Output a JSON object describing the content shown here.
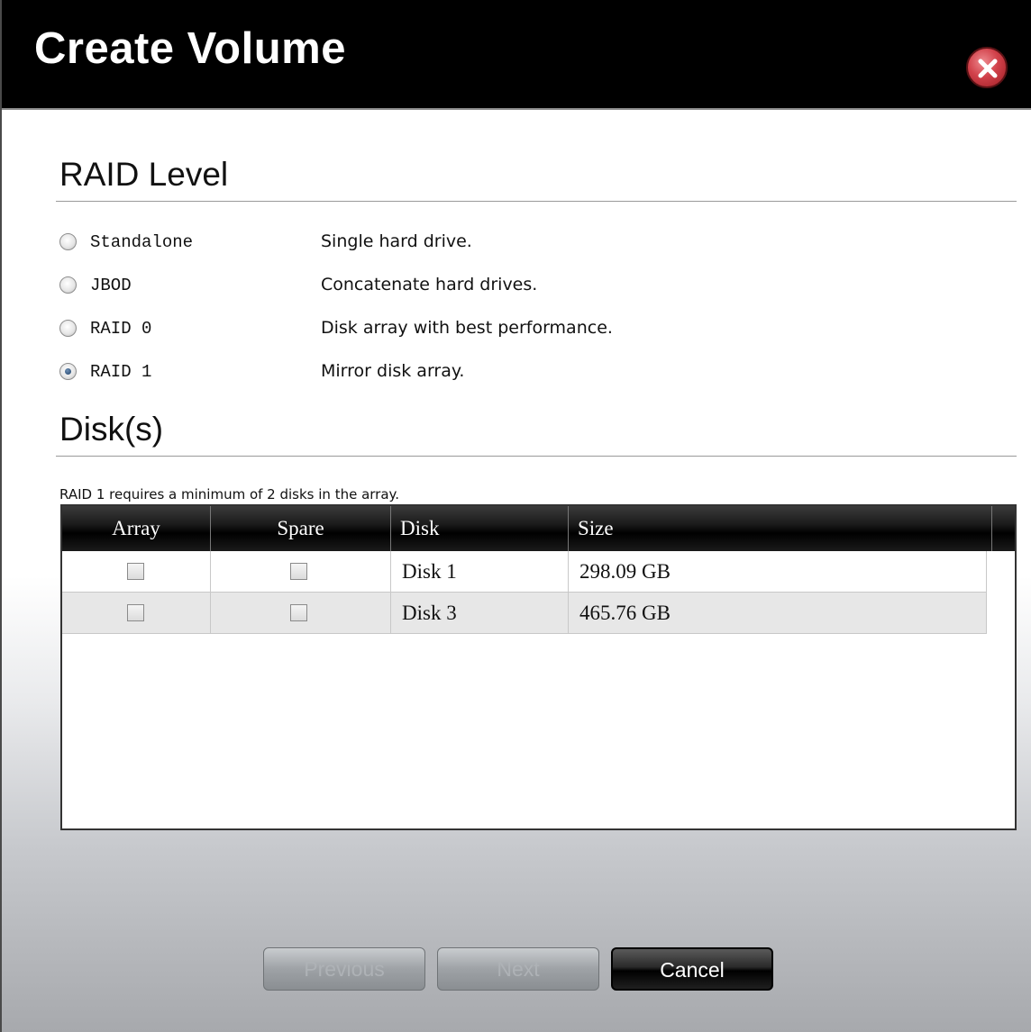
{
  "dialog": {
    "title": "Create Volume"
  },
  "raid_section": {
    "title": "RAID Level",
    "options": [
      {
        "label": "Standalone",
        "description": "Single hard drive.",
        "selected": false
      },
      {
        "label": "JBOD",
        "description": "Concatenate hard drives.",
        "selected": false
      },
      {
        "label": "RAID 0",
        "description": "Disk array with best performance.",
        "selected": false
      },
      {
        "label": "RAID 1",
        "description": "Mirror disk array.",
        "selected": true
      }
    ]
  },
  "disks_section": {
    "title": "Disk(s)",
    "note": "RAID 1 requires a minimum of 2 disks in the array.",
    "columns": [
      "Array",
      "Spare",
      "Disk",
      "Size"
    ],
    "rows": [
      {
        "array": false,
        "spare": false,
        "disk": "Disk 1",
        "size": "298.09 GB"
      },
      {
        "array": false,
        "spare": false,
        "disk": "Disk 3",
        "size": "465.76 GB"
      }
    ]
  },
  "buttons": {
    "previous": "Previous",
    "next": "Next",
    "cancel": "Cancel"
  },
  "colors": {
    "titlebar": "#000000",
    "close_button": "#d1414a",
    "grid_header": "#000000"
  }
}
